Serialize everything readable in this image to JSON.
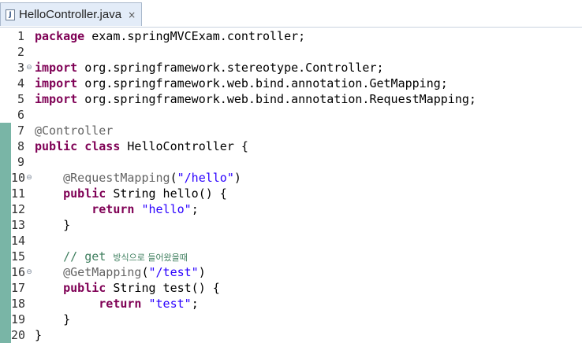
{
  "tab": {
    "title": "HelloController.java",
    "close_symbol": "×",
    "file_icon_letter": "J"
  },
  "lines": [
    {
      "num": "1",
      "modified": false,
      "fold": "",
      "tokens": [
        {
          "t": "package",
          "c": "kw"
        },
        {
          "t": " exam.springMVCExam.controller;",
          "c": "plain"
        }
      ]
    },
    {
      "num": "2",
      "modified": false,
      "fold": "",
      "tokens": []
    },
    {
      "num": "3",
      "modified": false,
      "fold": "⊖",
      "tokens": [
        {
          "t": "import",
          "c": "kw"
        },
        {
          "t": " org.springframework.stereotype.Controller;",
          "c": "plain"
        }
      ]
    },
    {
      "num": "4",
      "modified": false,
      "fold": "",
      "tokens": [
        {
          "t": "import",
          "c": "kw"
        },
        {
          "t": " org.springframework.web.bind.annotation.GetMapping;",
          "c": "plain"
        }
      ]
    },
    {
      "num": "5",
      "modified": false,
      "fold": "",
      "tokens": [
        {
          "t": "import",
          "c": "kw"
        },
        {
          "t": " org.springframework.web.bind.annotation.RequestMapping;",
          "c": "plain"
        }
      ]
    },
    {
      "num": "6",
      "modified": false,
      "fold": "",
      "tokens": []
    },
    {
      "num": "7",
      "modified": true,
      "fold": "",
      "tokens": [
        {
          "t": "@Controller",
          "c": "ann"
        }
      ]
    },
    {
      "num": "8",
      "modified": true,
      "fold": "",
      "tokens": [
        {
          "t": "public",
          "c": "kw"
        },
        {
          "t": " ",
          "c": "plain"
        },
        {
          "t": "class",
          "c": "kw"
        },
        {
          "t": " HelloController {",
          "c": "plain"
        }
      ]
    },
    {
      "num": "9",
      "modified": true,
      "fold": "",
      "tokens": []
    },
    {
      "num": "10",
      "modified": true,
      "fold": "⊖",
      "tokens": [
        {
          "t": "    ",
          "c": "plain"
        },
        {
          "t": "@RequestMapping",
          "c": "ann"
        },
        {
          "t": "(",
          "c": "plain"
        },
        {
          "t": "\"/hello\"",
          "c": "str"
        },
        {
          "t": ")",
          "c": "plain"
        }
      ]
    },
    {
      "num": "11",
      "modified": true,
      "fold": "",
      "tokens": [
        {
          "t": "    ",
          "c": "plain"
        },
        {
          "t": "public",
          "c": "kw"
        },
        {
          "t": " String hello() {",
          "c": "plain"
        }
      ]
    },
    {
      "num": "12",
      "modified": true,
      "fold": "",
      "tokens": [
        {
          "t": "        ",
          "c": "plain"
        },
        {
          "t": "return",
          "c": "kw"
        },
        {
          "t": " ",
          "c": "plain"
        },
        {
          "t": "\"hello\"",
          "c": "str"
        },
        {
          "t": ";",
          "c": "plain"
        }
      ]
    },
    {
      "num": "13",
      "modified": true,
      "fold": "",
      "tokens": [
        {
          "t": "    }",
          "c": "plain"
        }
      ]
    },
    {
      "num": "14",
      "modified": true,
      "fold": "",
      "tokens": []
    },
    {
      "num": "15",
      "modified": true,
      "fold": "",
      "tokens": [
        {
          "t": "    ",
          "c": "plain"
        },
        {
          "t": "// get ",
          "c": "cmt"
        },
        {
          "t": "방식으로 들어왔을때",
          "c": "cmt kor"
        }
      ]
    },
    {
      "num": "16",
      "modified": true,
      "fold": "⊖",
      "tokens": [
        {
          "t": "    ",
          "c": "plain"
        },
        {
          "t": "@GetMapping",
          "c": "ann"
        },
        {
          "t": "(",
          "c": "plain"
        },
        {
          "t": "\"/test\"",
          "c": "str"
        },
        {
          "t": ")",
          "c": "plain"
        }
      ]
    },
    {
      "num": "17",
      "modified": true,
      "fold": "",
      "tokens": [
        {
          "t": "    ",
          "c": "plain"
        },
        {
          "t": "public",
          "c": "kw"
        },
        {
          "t": " String test() {",
          "c": "plain"
        }
      ]
    },
    {
      "num": "18",
      "modified": true,
      "fold": "",
      "tokens": [
        {
          "t": "         ",
          "c": "plain"
        },
        {
          "t": "return",
          "c": "kw"
        },
        {
          "t": " ",
          "c": "plain"
        },
        {
          "t": "\"test\"",
          "c": "str"
        },
        {
          "t": ";",
          "c": "plain"
        }
      ]
    },
    {
      "num": "19",
      "modified": true,
      "fold": "",
      "tokens": [
        {
          "t": "    }",
          "c": "plain"
        }
      ]
    },
    {
      "num": "20",
      "modified": true,
      "fold": "",
      "tokens": [
        {
          "t": "}",
          "c": "plain"
        }
      ]
    }
  ]
}
